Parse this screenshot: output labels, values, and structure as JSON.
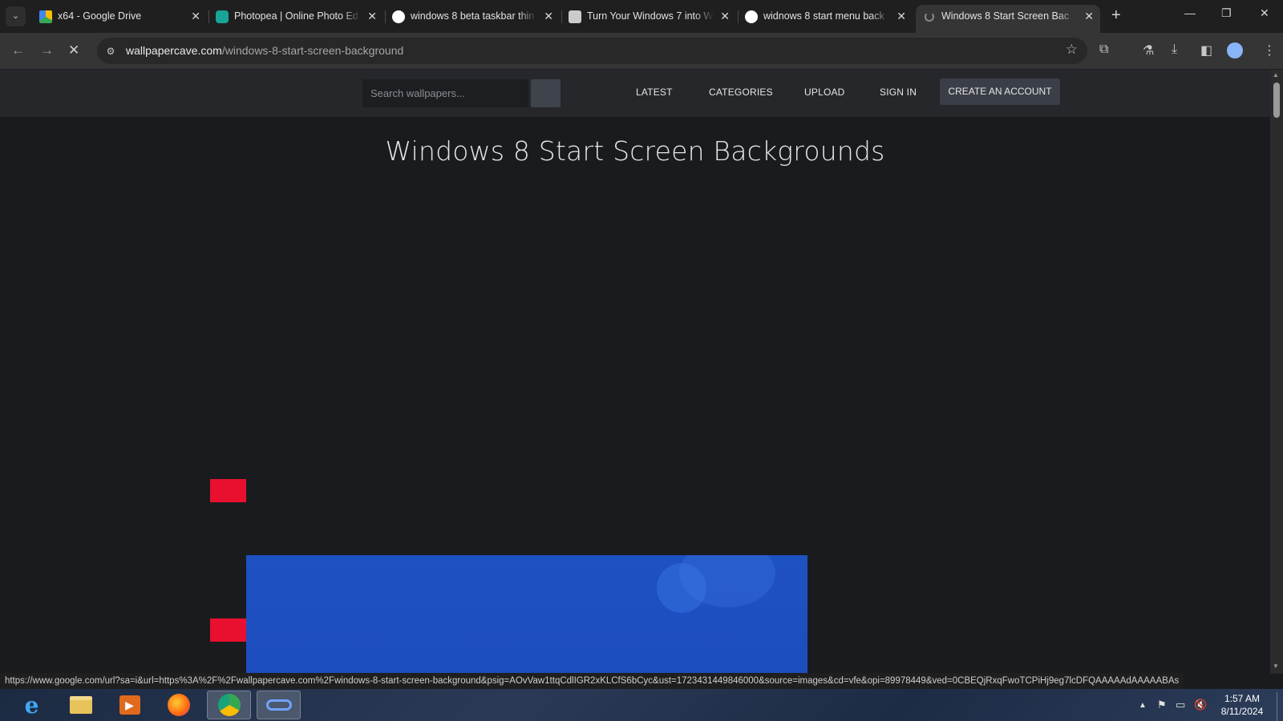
{
  "browser": {
    "tabs": [
      {
        "title": "x64 - Google Drive",
        "icon": "google-drive-icon",
        "color": "#4285f4"
      },
      {
        "title": "Photopea | Online Photo Ed",
        "icon": "photopea-icon",
        "color": "#18a497"
      },
      {
        "title": "windows 8 beta taskbar thin",
        "icon": "google-icon",
        "color": "#ffffff"
      },
      {
        "title": "Turn Your Windows 7 into W",
        "icon": "site-icon",
        "color": "#cccccc"
      },
      {
        "title": "widnows 8 start menu back",
        "icon": "google-icon",
        "color": "#ffffff"
      },
      {
        "title": "Windows 8 Start Screen Bac",
        "icon": "loading-icon",
        "color": "#888888"
      }
    ],
    "url_domain": "wallpapercave.com",
    "url_path": "/windows-8-start-screen-background",
    "status_url": "https://www.google.com/url?sa=i&url=https%3A%2F%2Fwallpapercave.com%2Fwindows-8-start-screen-background&psig=AOvVaw1ttqCdlIGR2xKLCfS6bCyc&ust=1723431449846000&source=images&cd=vfe&opi=89978449&ved=0CBEQjRxqFwoTCPiHj9eg7lcDFQAAAAAdAAAAABAs"
  },
  "site": {
    "search_placeholder": "Search wallpapers...",
    "nav": {
      "latest": "LATEST",
      "categories": "CATEGORIES",
      "upload": "UPLOAD",
      "sign_in": "SIGN IN",
      "create_account": "CREATE AN ACCOUNT"
    },
    "page_title": "Windows 8 Start Screen Backgrounds",
    "accent_red": "#e8102e",
    "wallpaper_color": "#1e51c2"
  },
  "taskbar": {
    "apps": [
      "internet-explorer-icon",
      "file-explorer-icon",
      "media-player-icon",
      "firefox-icon",
      "chrome-icon",
      "app-icon"
    ],
    "time": "1:57 AM",
    "date": "8/11/2024"
  }
}
